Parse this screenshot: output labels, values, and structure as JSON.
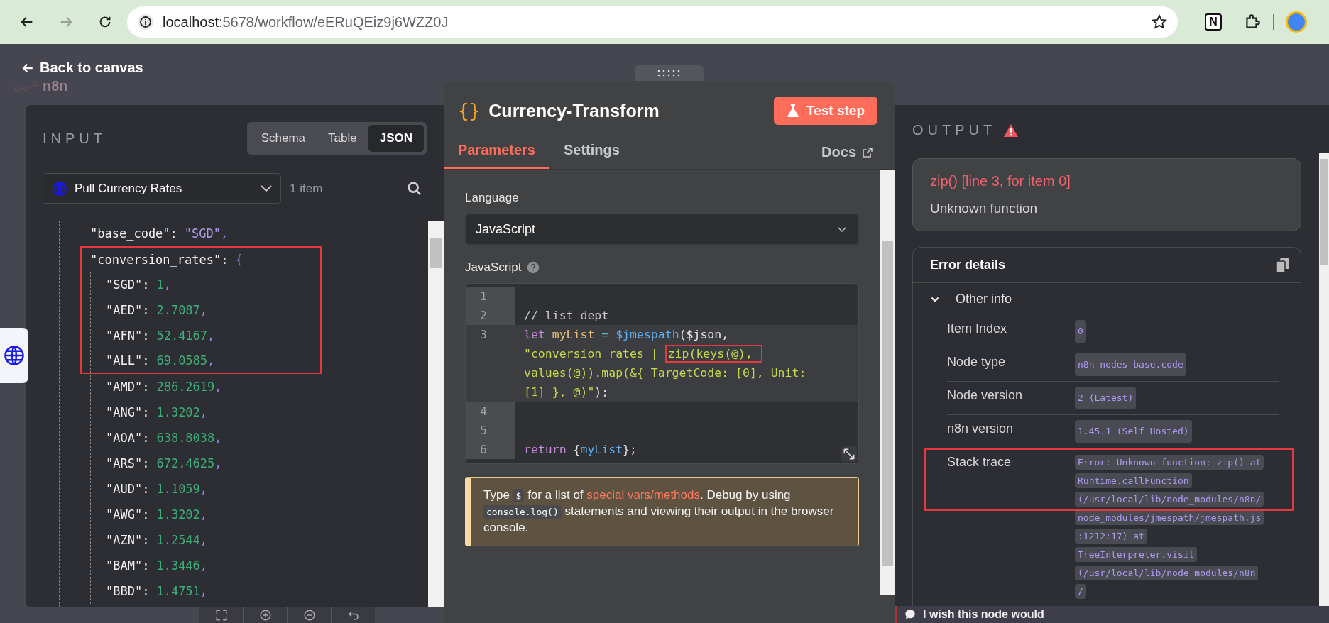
{
  "browser": {
    "url_host": "localhost",
    "url_path": ":5678/workflow/eERuQEiz9j6WZZ0J",
    "extension_letter": "N"
  },
  "canvas": {
    "back_link": "Back to canvas",
    "logo": "n8n"
  },
  "input": {
    "title": "INPUT",
    "view_tabs": [
      {
        "label": "Schema",
        "selected": false
      },
      {
        "label": "Table",
        "selected": false
      },
      {
        "label": "JSON",
        "selected": true
      }
    ],
    "source": "Pull Currency Rates",
    "count": "1 item",
    "json": [
      {
        "key": "\"base_code\":",
        "value": "\"SGD\"",
        "kind": "string",
        "comma": ",",
        "highlighted": false
      },
      {
        "key": "\"conversion_rates\":",
        "value": "{",
        "kind": "object",
        "highlighted": true,
        "children": [
          {
            "key": "\"SGD\":",
            "value": "1",
            "kind": "number",
            "comma": ",",
            "highlighted": true
          },
          {
            "key": "\"AED\":",
            "value": "2.7087",
            "kind": "number",
            "comma": ",",
            "highlighted": true
          },
          {
            "key": "\"AFN\":",
            "value": "52.4167",
            "kind": "number",
            "comma": ",",
            "highlighted": true
          },
          {
            "key": "\"ALL\":",
            "value": "69.0585",
            "kind": "number",
            "comma": ",",
            "highlighted": true
          },
          {
            "key": "\"AMD\":",
            "value": "286.2619",
            "kind": "number",
            "comma": ",",
            "highlighted": false
          },
          {
            "key": "\"ANG\":",
            "value": "1.3202",
            "kind": "number",
            "comma": ",",
            "highlighted": false
          },
          {
            "key": "\"AOA\":",
            "value": "638.8038",
            "kind": "number",
            "comma": ",",
            "highlighted": false
          },
          {
            "key": "\"ARS\":",
            "value": "672.4625",
            "kind": "number",
            "comma": ",",
            "highlighted": false
          },
          {
            "key": "\"AUD\":",
            "value": "1.1059",
            "kind": "number",
            "comma": ",",
            "highlighted": false
          },
          {
            "key": "\"AWG\":",
            "value": "1.3202",
            "kind": "number",
            "comma": ",",
            "highlighted": false
          },
          {
            "key": "\"AZN\":",
            "value": "1.2544",
            "kind": "number",
            "comma": ",",
            "highlighted": false
          },
          {
            "key": "\"BAM\":",
            "value": "1.3446",
            "kind": "number",
            "comma": ",",
            "highlighted": false
          },
          {
            "key": "\"BBD\":",
            "value": "1.4751",
            "kind": "number",
            "comma": ",",
            "highlighted": false
          }
        ]
      }
    ]
  },
  "node": {
    "icon": "{}",
    "title": "Currency-Transform",
    "test_button": "Test step",
    "tabs": [
      {
        "label": "Parameters",
        "selected": true
      },
      {
        "label": "Settings",
        "selected": false
      }
    ],
    "docs_link": "Docs",
    "language_label": "Language",
    "language_value": "JavaScript",
    "code_label": "JavaScript",
    "code_lines": [
      {
        "number": "1",
        "active": false
      },
      {
        "number": "2",
        "active": false,
        "tokens": [
          {
            "text": "// list dept",
            "kind": "comment",
            "highlighted": false
          }
        ]
      },
      {
        "number": "3",
        "active": true,
        "tokens": [
          {
            "text": "let",
            "kind": "keyword",
            "highlighted": false
          },
          {
            "text": " myList",
            "kind": "variable",
            "highlighted": false
          },
          {
            "text": " = ",
            "kind": "operator",
            "highlighted": false
          },
          {
            "text": "$jmespath",
            "kind": "function",
            "highlighted": false
          },
          {
            "text": "($json, ",
            "kind": "plain",
            "highlighted": false
          },
          {
            "text": "\"conversion_rates | ",
            "kind": "string",
            "highlighted": false
          },
          {
            "text": "zip(keys(@), ",
            "kind": "string",
            "highlighted": true
          },
          {
            "text": "values(@)).map(&{ TargetCode: [0], Unit: [1] }, @)\"",
            "kind": "string",
            "highlighted": false
          },
          {
            "text": ");",
            "kind": "plain",
            "highlighted": false
          }
        ]
      },
      {
        "number": "4",
        "active": false
      },
      {
        "number": "5",
        "active": false
      },
      {
        "number": "6",
        "active": false,
        "tokens": [
          {
            "text": "return",
            "kind": "keyword",
            "highlighted": false
          },
          {
            "text": " {",
            "kind": "plain",
            "highlighted": false
          },
          {
            "text": "myList",
            "kind": "function",
            "highlighted": false
          },
          {
            "text": "};",
            "kind": "plain",
            "highlighted": false
          }
        ]
      }
    ],
    "hint": [
      {
        "text": "Type ",
        "kind": "text"
      },
      {
        "text": "$",
        "kind": "code"
      },
      {
        "text": " for a list of ",
        "kind": "text"
      },
      {
        "text": "special vars/methods",
        "kind": "link"
      },
      {
        "text": ". Debug by using ",
        "kind": "text"
      },
      {
        "text": "console.log()",
        "kind": "code"
      },
      {
        "text": " statements and viewing their output in the browser console.",
        "kind": "text"
      }
    ]
  },
  "output": {
    "title": "OUTPUT",
    "error_title": "zip() [line 3, for item 0]",
    "error_message": "Unknown function",
    "details_title": "Error details",
    "section": {
      "label": "Other info",
      "expanded": true
    },
    "rows": [
      {
        "label": "Item Index",
        "value": "0",
        "highlighted": false
      },
      {
        "label": "Node type",
        "value": "n8n-nodes-base.code",
        "highlighted": false
      },
      {
        "label": "Node version",
        "value": "2 (Latest)",
        "highlighted": false
      },
      {
        "label": "n8n version",
        "value": "1.45.1 (Self Hosted)",
        "highlighted": false
      },
      {
        "label": "Stack trace",
        "value": "Error: Unknown function: zip() at Runtime.callFunction (/usr/local/lib/node_modules/n8n/node_modules/jmespath/jmespath.js:1212:17) at TreeInterpreter.visit (/usr/local/lib/node_modules/n8n/",
        "highlighted": true
      }
    ]
  },
  "feedback": "I wish this node would"
}
